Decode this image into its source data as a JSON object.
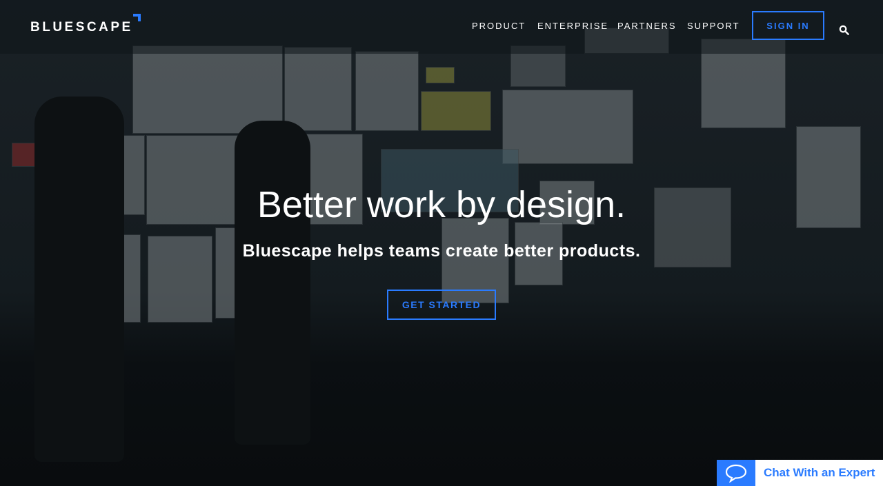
{
  "header": {
    "logo": "BLUESCAPE",
    "nav": [
      {
        "label": "PRODUCT"
      },
      {
        "label": "ENTERPRISE"
      },
      {
        "label": "PARTNERS"
      },
      {
        "label": "SUPPORT"
      }
    ],
    "sign_in": "SIGN IN",
    "search_icon": "search-icon"
  },
  "hero": {
    "title": "Better work by design.",
    "subtitle": "Bluescape helps teams create better products.",
    "cta": "GET STARTED"
  },
  "chat": {
    "label": "Chat With an Expert",
    "icon": "chat-bubble-icon"
  },
  "colors": {
    "accent": "#2a7bff",
    "background": "#0c1114"
  }
}
